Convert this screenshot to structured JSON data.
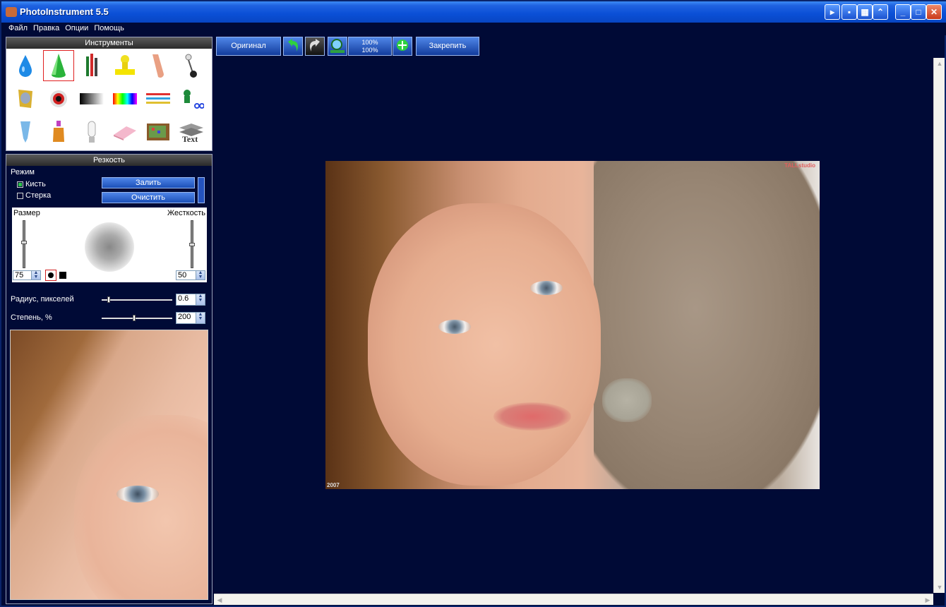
{
  "window": {
    "title": "PhotoInstrument 5.5"
  },
  "menu": [
    "Файл",
    "Правка",
    "Опции",
    "Помощь"
  ],
  "toolbar": {
    "original_label": "Оригинал",
    "zoom_100_top": "100%",
    "zoom_100_bottom": "100%",
    "pin_label": "Закрепить"
  },
  "tools_panel": {
    "title": "Инструменты"
  },
  "sharpness_panel": {
    "title": "Резкость",
    "mode_label": "Режим",
    "mode_brush": "Кисть",
    "mode_eraser": "Стерка",
    "brush_checked": true,
    "eraser_checked": false,
    "fill_button": "Залить",
    "clear_button": "Очистить",
    "size_label": "Размер",
    "hardness_label": "Жесткость",
    "size_value": "75",
    "hardness_value": "50",
    "radius_label": "Радиус, пикселей",
    "radius_value": "0.6",
    "amount_label": "Степень, %",
    "amount_value": "200"
  },
  "photo": {
    "watermark_top": "TALLstudio",
    "watermark_bottom": "2007"
  },
  "colors": {
    "background": "#000a36",
    "titlebar": "#0a4fd6",
    "button": "#1b4fb8",
    "selection": "#e02020"
  }
}
